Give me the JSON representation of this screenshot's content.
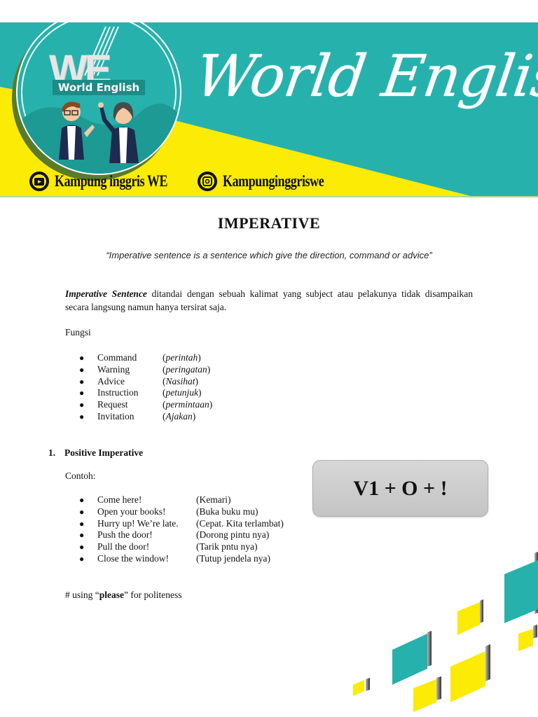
{
  "banner": {
    "logo_letters": "WE",
    "logo_label": "World English",
    "script_title": "World English",
    "colors": {
      "teal": "#27b1ac",
      "yellow": "#fbeb05"
    },
    "social": [
      {
        "icon": "youtube-icon",
        "label": "Kampung inggris WE"
      },
      {
        "icon": "instagram-icon",
        "label": "Kampunginggriswe"
      }
    ]
  },
  "document": {
    "title": "IMPERATIVE",
    "quote": "“Imperative sentence is a sentence which give the direction, command or advice”",
    "intro": {
      "lead": "Imperative Sentence",
      "text": " ditandai dengan sebuah kalimat yang subject atau pelakunya tidak disampaikan secara langsung namun hanya tersirat saja."
    },
    "fungsi_label": "Fungsi",
    "fungsi": [
      {
        "en": "Command",
        "id": "perintah"
      },
      {
        "en": "Warning",
        "id": "peringatan"
      },
      {
        "en": "Advice",
        "id": "Nasihat"
      },
      {
        "en": "Instruction",
        "id": "petunjuk"
      },
      {
        "en": "Request",
        "id": "permintaan"
      },
      {
        "en": "Invitation",
        "id": "Ajakan"
      }
    ],
    "section1": {
      "number": "1.",
      "title": "Positive Imperative"
    },
    "contoh_label": "Contoh:",
    "examples": [
      {
        "en": "Come here!",
        "id": "(Kemari)"
      },
      {
        "en": "Open your books!",
        "id": "(Buka buku mu)"
      },
      {
        "en": "Hurry up! We’re late.",
        "id": "(Cepat. Kita terlambat)"
      },
      {
        "en": "Push the door!",
        "id": "(Dorong pintu nya)"
      },
      {
        "en": "Pull the door!",
        "id": "(Tarik pntu nya)"
      },
      {
        "en": "Close the window!",
        "id": "(Tutup jendela nya)"
      }
    ],
    "formula": "V1 + O + !",
    "please_note": {
      "prefix": "# using “",
      "bold": "please",
      "suffix": "” for politeness"
    }
  }
}
